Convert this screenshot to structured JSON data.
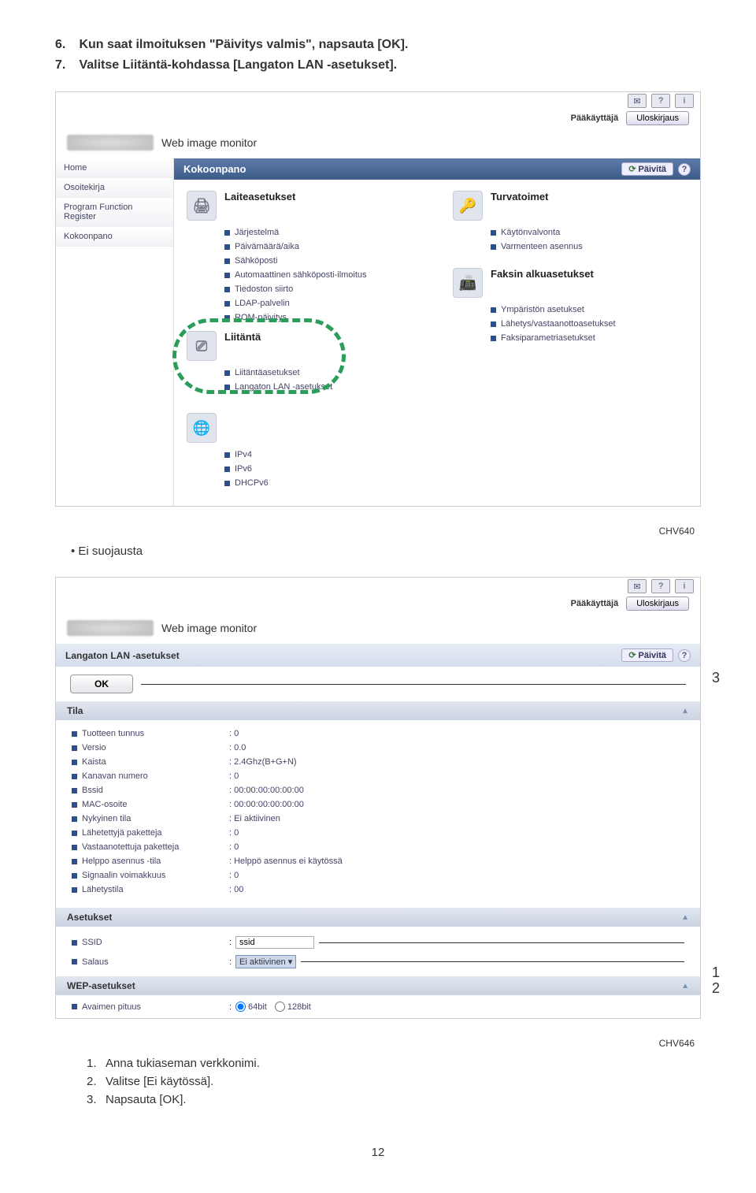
{
  "instructions": {
    "line6": "Kun saat ilmoituksen \"Päivitys valmis\", napsauta [OK].",
    "line7": "Valitse Liitäntä-kohdassa [Langaton LAN -asetukset].",
    "num6": "6.",
    "num7": "7."
  },
  "img_code1": "CHV640",
  "img_code2": "CHV646",
  "bullet_ei": "Ei suojausta",
  "sub": {
    "n1": "1.",
    "t1": "Anna tukiaseman verkkonimi.",
    "n2": "2.",
    "t2": "Valitse [Ei käytössä].",
    "n3": "3.",
    "t3": "Napsauta [OK]."
  },
  "page_num": "12",
  "shot1": {
    "title": "Web image monitor",
    "paakayt": "Pääkäyttäjä",
    "ulos": "Uloskirjaus",
    "panel_title": "Kokoonpano",
    "refresh": "Päivitä",
    "sidebar": [
      "Home",
      "Osoitekirja",
      "Program Function Register",
      "Kokoonpano"
    ],
    "sec_laite": "Laiteasetukset",
    "laite_items": [
      "Järjestelmä",
      "Päivämäärä/aika",
      "Sähköposti",
      "Automaattinen sähköposti-ilmoitus",
      "Tiedoston siirto",
      "LDAP-palvelin",
      "ROM-päivitys"
    ],
    "sec_turva": "Turvatoimet",
    "turva_items": [
      "Käytönvalvonta",
      "Varmenteen asennus"
    ],
    "sec_faksi": "Faksin alkuasetukset",
    "faksi_items": [
      "Ympäristön asetukset",
      "Lähetys/vastaanottoasetukset",
      "Faksiparametriasetukset"
    ],
    "sec_liit": "Liitäntä",
    "liit_items": [
      "Liitäntäasetukset",
      "Langaton LAN -asetukset"
    ],
    "net_items": [
      "IPv4",
      "IPv6",
      "DHCPv6"
    ]
  },
  "shot2": {
    "title": "Web image monitor",
    "paakayt": "Pääkäyttäjä",
    "ulos": "Uloskirjaus",
    "panel_title": "Langaton LAN -asetukset",
    "refresh": "Päivitä",
    "ok": "OK",
    "sec_tila": "Tila",
    "tila": [
      {
        "k": "Tuotteen tunnus",
        "v": ": 0"
      },
      {
        "k": "Versio",
        "v": ": 0.0"
      },
      {
        "k": "Kaista",
        "v": ": 2.4Ghz(B+G+N)"
      },
      {
        "k": "Kanavan numero",
        "v": ": 0"
      },
      {
        "k": "Bssid",
        "v": ": 00:00:00:00:00:00"
      },
      {
        "k": "MAC-osoite",
        "v": ": 00:00:00:00:00:00"
      },
      {
        "k": "Nykyinen tila",
        "v": ": Ei aktiivinen"
      },
      {
        "k": "Lähetettyjä paketteja",
        "v": ": 0"
      },
      {
        "k": "Vastaanotettuja paketteja",
        "v": ": 0"
      },
      {
        "k": "Helppo asennus -tila",
        "v": ": Helppö asennus ei käytössä"
      },
      {
        "k": "Signaalin voimakkuus",
        "v": ": 0"
      },
      {
        "k": "Lähetystila",
        "v": ": 00"
      }
    ],
    "sec_aset": "Asetukset",
    "ssid_label": "SSID",
    "ssid_val": "ssid",
    "salaus_label": "Salaus",
    "salaus_val": "Ei aktiivinen",
    "sec_wep": "WEP-asetukset",
    "avain_label": "Avaimen pituus",
    "avain_opt1": "64bit",
    "avain_opt2": "128bit"
  },
  "callouts": {
    "c1": "1",
    "c2": "2",
    "c3": "3"
  }
}
